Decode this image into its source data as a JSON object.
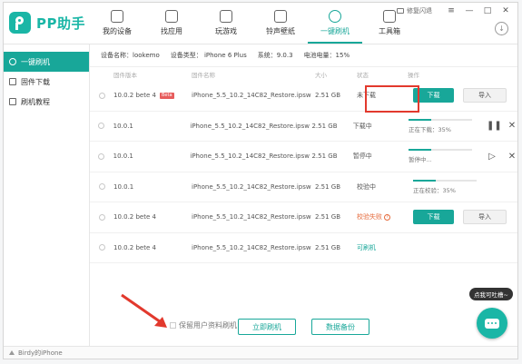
{
  "app": {
    "name": "PP助手"
  },
  "nav": [
    {
      "label": "我的设备",
      "icon": "phone-icon"
    },
    {
      "label": "找应用",
      "icon": "bag-icon"
    },
    {
      "label": "玩游戏",
      "icon": "gamepad-icon"
    },
    {
      "label": "铃声壁纸",
      "icon": "bell-icon"
    },
    {
      "label": "一键刷机",
      "icon": "refresh-icon",
      "active": true
    },
    {
      "label": "工具箱",
      "icon": "toolbox-icon"
    }
  ],
  "window": {
    "feedback": "修复闪退",
    "menu": "≡",
    "min": "—",
    "max": "□",
    "close": "✕",
    "download": "↓"
  },
  "sidebar": {
    "items": [
      {
        "label": "一键刷机",
        "active": true
      },
      {
        "label": "固件下载"
      },
      {
        "label": "刷机教程"
      }
    ]
  },
  "status_bar": {
    "device": "Birdy的iPhone"
  },
  "device_info": {
    "name": "设备名称：lookemo",
    "type": "设备类型： iPhone 6 Plus",
    "system": "系统：9.0.3",
    "battery": "电池电量：15%"
  },
  "table": {
    "headers": [
      "固件版本",
      "固件名称",
      "大小",
      "状态",
      "操作"
    ],
    "rows": [
      {
        "version": "10.0.2 bete 4",
        "tag": "Beta",
        "name": "iPhone_5.5_10.2_14C82_Restore.ipsw",
        "size": "2.51 GB",
        "state": "未下载",
        "op": "buttons"
      },
      {
        "version": "10.0.1",
        "name": "iPhone_5.5_10.2_14C82_Restore.ipsw",
        "size": "2.51 GB",
        "state": "下载中",
        "op": "progress",
        "progress_text": "正在下载：35%",
        "progress": 0.35,
        "ctl": "pause"
      },
      {
        "version": "10.0.1",
        "name": "iPhone_5.5_10.2_14C82_Restore.ipsw",
        "size": "2.51 GB",
        "state": "暂停中",
        "op": "progress",
        "progress_text": "暂停中...",
        "progress": 0.35,
        "ctl": "play"
      },
      {
        "version": "10.0.1",
        "name": "iPhone_5.5_10.2_14C82_Restore.ipsw",
        "size": "2.51 GB",
        "state": "校验中",
        "op": "progress",
        "progress_text": "正在校验：35%",
        "progress": 0.35
      },
      {
        "version": "10.0.2 bete 4",
        "name": "iPhone_5.5_10.2_14C82_Restore.ipsw",
        "size": "2.51 GB",
        "state": "校验失败",
        "op": "buttons"
      },
      {
        "version": "10.0.2 bete 4",
        "name": "iPhone_5.5_10.2_14C82_Restore.ipsw",
        "size": "2.51 GB",
        "state": "可刷机",
        "op": "none"
      }
    ],
    "download_label": "下载",
    "import_label": "导入"
  },
  "bottom": {
    "keep_data": "保留用户资料刷机",
    "flash_now": "立即刷机",
    "backup": "数据备份"
  },
  "chat": {
    "tip": "点我可吐槽~"
  },
  "colors": {
    "accent": "#18a799",
    "highlight": "#e2392d",
    "error": "#e56a3b"
  }
}
